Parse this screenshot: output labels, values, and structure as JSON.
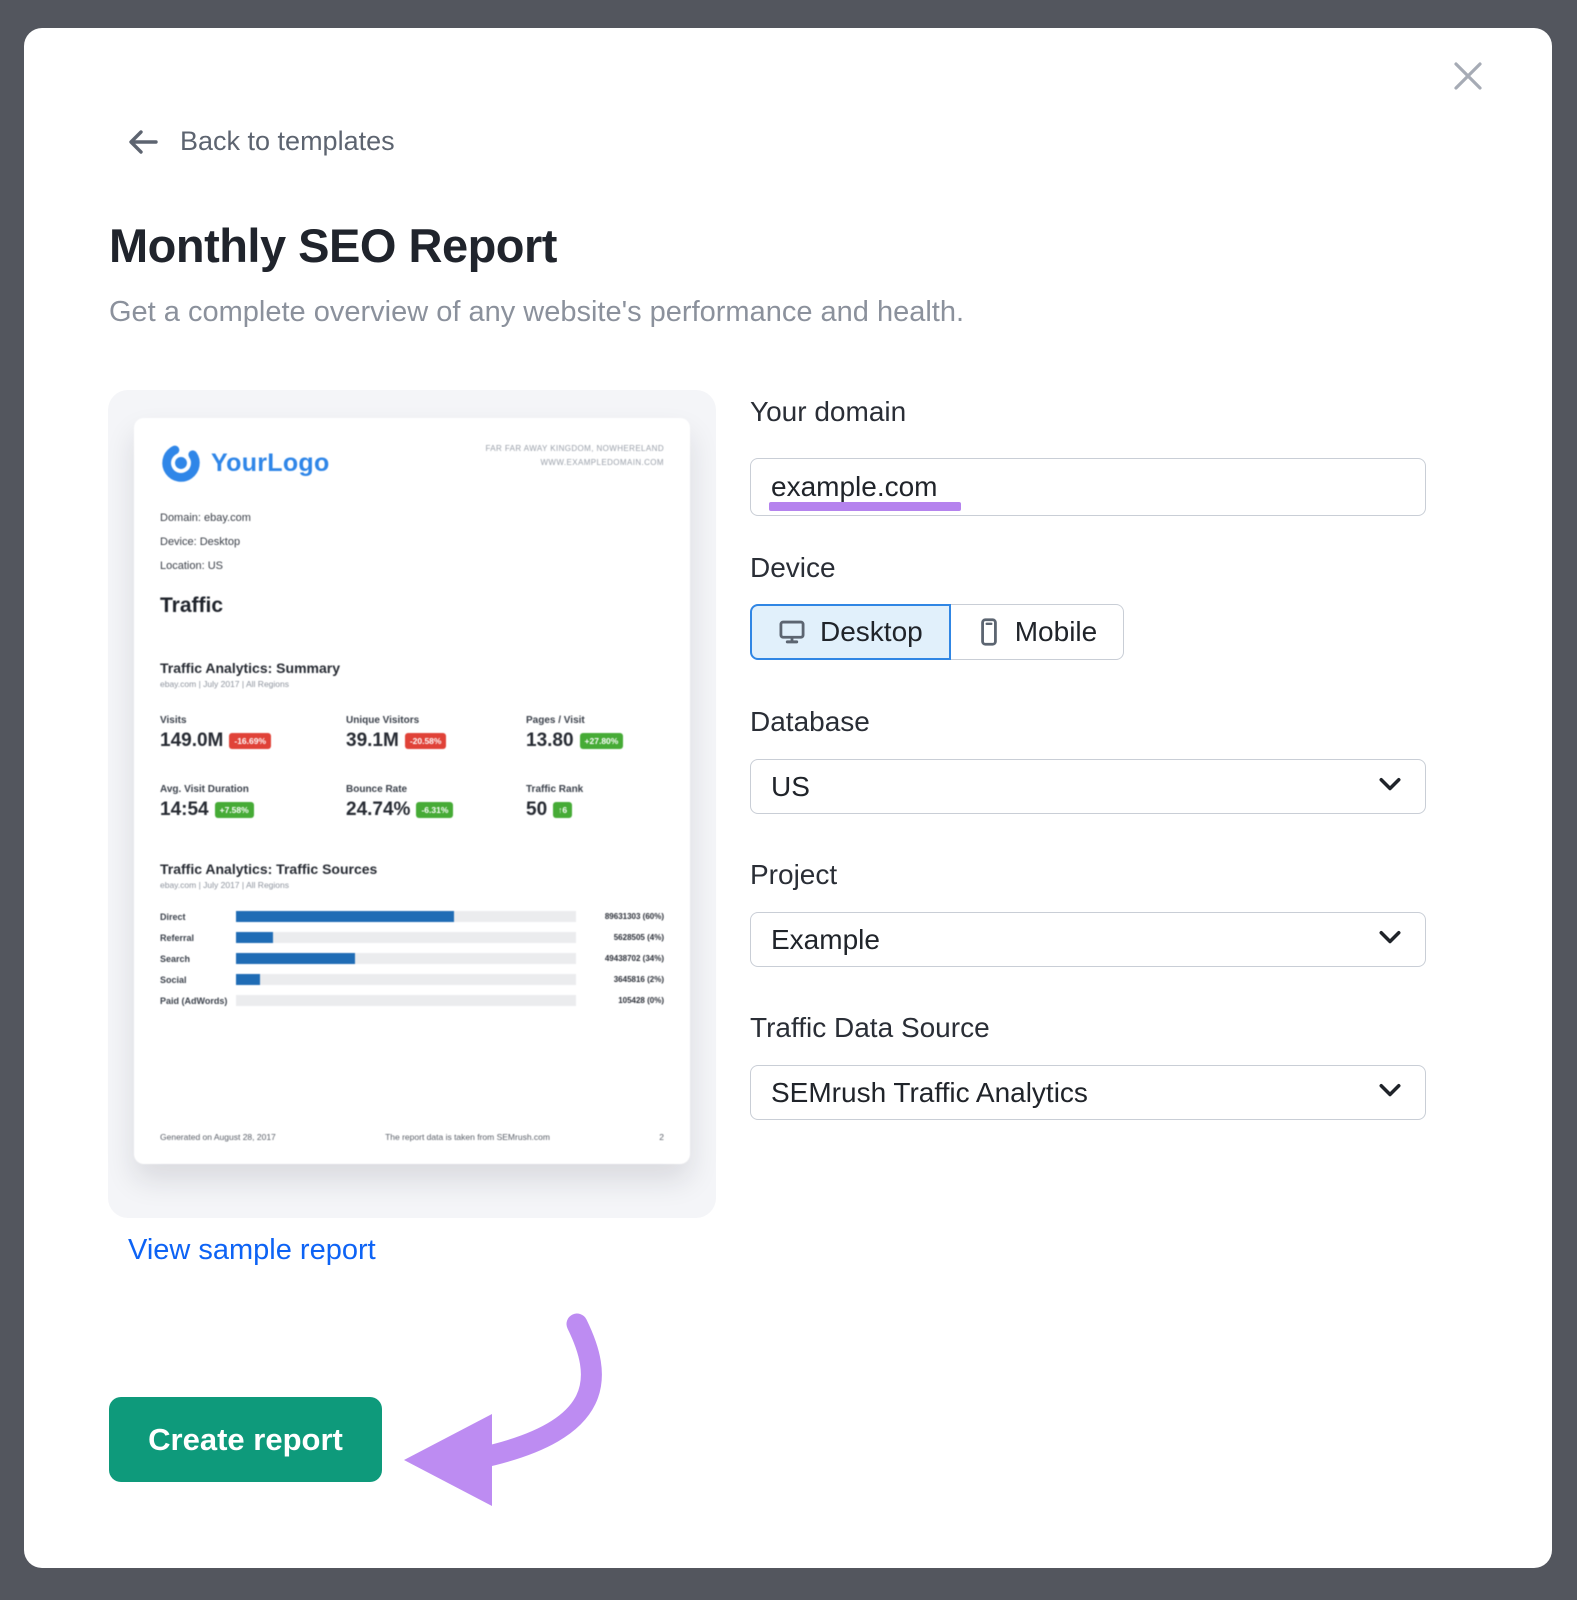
{
  "modal": {
    "back_label": "Back to templates",
    "title": "Monthly SEO Report",
    "subtitle": "Get a complete overview of any website's performance and health."
  },
  "icons": {
    "close": "x-icon",
    "back": "arrow-left-icon",
    "desktop": "monitor-icon",
    "mobile": "smartphone-icon",
    "select": "chevron-down-icon",
    "logo": "circle-logo-icon",
    "annotation": "purple-curved-arrow"
  },
  "form": {
    "domain_label": "Your domain",
    "domain_value": "example.com",
    "device_label": "Device",
    "device_selected": "Desktop",
    "device_options": {
      "desktop": "Desktop",
      "mobile": "Mobile"
    },
    "database_label": "Database",
    "database_value": "US",
    "project_label": "Project",
    "project_value": "Example",
    "traffic_source_label": "Traffic Data Source",
    "traffic_source_value": "SEMrush Traffic Analytics"
  },
  "preview": {
    "logo_text": "YourLogo",
    "address_line1": "FAR FAR AWAY KINGDOM, NOWHERELAND",
    "address_line2": "WWW.EXAMPLEDOMAIN.COM",
    "meta": {
      "domain": "Domain: ebay.com",
      "device": "Device: Desktop",
      "location": "Location: US"
    },
    "section_title": "Traffic",
    "summary_title": "Traffic Analytics: Summary",
    "summary_subtitle": "ebay.com | July 2017 | All Regions",
    "stats": [
      {
        "label": "Visits",
        "value": "149.0M",
        "badge": "-16.69%",
        "badge_color": "red"
      },
      {
        "label": "Unique Visitors",
        "value": "39.1M",
        "badge": "-20.58%",
        "badge_color": "red"
      },
      {
        "label": "Pages / Visit",
        "value": "13.80",
        "badge": "+27.80%",
        "badge_color": "green"
      },
      {
        "label": "Avg. Visit Duration",
        "value": "14:54",
        "badge": "+7.58%",
        "badge_color": "green"
      },
      {
        "label": "Bounce Rate",
        "value": "24.74%",
        "badge": "-6.31%",
        "badge_color": "green"
      },
      {
        "label": "Traffic Rank",
        "value": "50",
        "badge": "↑6",
        "badge_color": "green"
      }
    ],
    "sources_title": "Traffic Analytics: Traffic Sources",
    "sources_subtitle": "ebay.com | July 2017 | All Regions",
    "sources": [
      {
        "label": "Direct",
        "value": "89631303 (60%)",
        "pct": 64
      },
      {
        "label": "Referral",
        "value": "5628505 (4%)",
        "pct": 11
      },
      {
        "label": "Search",
        "value": "49438702 (34%)",
        "pct": 35
      },
      {
        "label": "Social",
        "value": "3645816 (2%)",
        "pct": 7
      },
      {
        "label": "Paid (AdWords)",
        "value": "105428 (0%)",
        "pct": 0
      }
    ],
    "footer_left": "Generated on August 28, 2017",
    "footer_center": "The report data is taken from SEMrush.com",
    "footer_right": "2"
  },
  "actions": {
    "view_sample_label": "View sample report",
    "create_report_label": "Create report"
  },
  "colors": {
    "backdrop": "#53565e",
    "accent_blue": "#3086e4",
    "link_blue": "#0d63f5",
    "button_green": "#0e9a7b",
    "annotation_purple": "#bd8cf2",
    "underline_purple": "#b583ee",
    "bar_blue": "#1f6cb5",
    "badge_red": "#e04238",
    "badge_green": "#46ab36"
  }
}
